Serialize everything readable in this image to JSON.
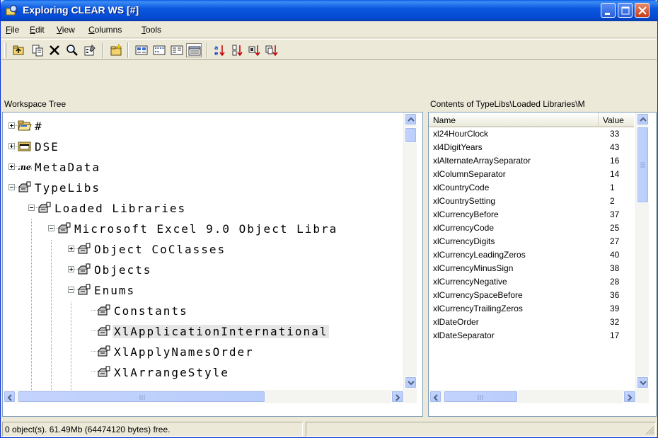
{
  "window": {
    "title": "Exploring CLEAR WS [#]"
  },
  "menu": [
    {
      "label": "File",
      "acc": "F",
      "rest": "ile"
    },
    {
      "label": "Edit",
      "acc": "E",
      "rest": "dit"
    },
    {
      "label": "View",
      "acc": "V",
      "rest": "iew"
    },
    {
      "label": "Columns",
      "acc": "C",
      "rest": "olumns"
    },
    {
      "label": "Tools",
      "acc": "T",
      "rest": "ools"
    }
  ],
  "left_pane": {
    "header": "Workspace Tree",
    "nodes": [
      {
        "label": "#",
        "icon": "folder-open-icon",
        "expander": "+"
      },
      {
        "label": "DSE",
        "icon": "folder-icon",
        "expander": "+"
      },
      {
        "label": "MetaData",
        "icon": "net-icon",
        "expander": "+"
      },
      {
        "label": "TypeLibs",
        "icon": "typelib-icon",
        "expander": "-"
      },
      {
        "label": "Loaded Libraries",
        "icon": "typelib-icon",
        "expander": "-"
      },
      {
        "label": "Microsoft Excel 9.0 Object Libra",
        "icon": "typelib-icon",
        "expander": "-"
      },
      {
        "label": "Object CoClasses",
        "icon": "typelib-icon",
        "expander": "+"
      },
      {
        "label": "Objects",
        "icon": "typelib-icon",
        "expander": "+"
      },
      {
        "label": "Enums",
        "icon": "typelib-icon",
        "expander": "-"
      },
      {
        "label": "Constants",
        "icon": "typelib-icon",
        "expander": ""
      },
      {
        "label": "XlApplicationInternational",
        "icon": "typelib-icon",
        "expander": "",
        "selected": true
      },
      {
        "label": "XlApplyNamesOrder",
        "icon": "typelib-icon",
        "expander": ""
      },
      {
        "label": "XlArrangeStyle",
        "icon": "typelib-icon",
        "expander": ""
      }
    ]
  },
  "right_pane": {
    "header": "Contents of TypeLibs\\Loaded Libraries\\M",
    "columns": [
      "Name",
      "Value"
    ],
    "rows": [
      [
        "xl24HourClock",
        "33"
      ],
      [
        "xl4DigitYears",
        "43"
      ],
      [
        "xlAlternateArraySeparator",
        "16"
      ],
      [
        "xlColumnSeparator",
        "14"
      ],
      [
        "xlCountryCode",
        "1"
      ],
      [
        "xlCountrySetting",
        "2"
      ],
      [
        "xlCurrencyBefore",
        "37"
      ],
      [
        "xlCurrencyCode",
        "25"
      ],
      [
        "xlCurrencyDigits",
        "27"
      ],
      [
        "xlCurrencyLeadingZeros",
        "40"
      ],
      [
        "xlCurrencyMinusSign",
        "38"
      ],
      [
        "xlCurrencyNegative",
        "28"
      ],
      [
        "xlCurrencySpaceBefore",
        "36"
      ],
      [
        "xlCurrencyTrailingZeros",
        "39"
      ],
      [
        "xlDateOrder",
        "32"
      ],
      [
        "xlDateSeparator",
        "17"
      ]
    ]
  },
  "statusbar": {
    "text": "0 object(s). 61.49Mb (64474120 bytes) free."
  },
  "colors": {
    "title_blue": "#0a5ae8",
    "close_red": "#c83b17",
    "border": "#7f9db9"
  }
}
